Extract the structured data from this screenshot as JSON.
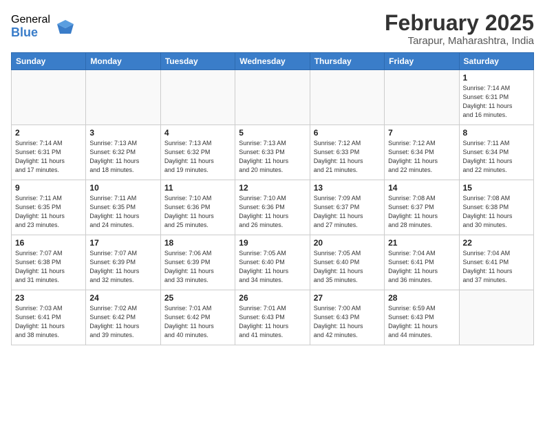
{
  "header": {
    "logo_general": "General",
    "logo_blue": "Blue",
    "month_title": "February 2025",
    "location": "Tarapur, Maharashtra, India"
  },
  "weekdays": [
    "Sunday",
    "Monday",
    "Tuesday",
    "Wednesday",
    "Thursday",
    "Friday",
    "Saturday"
  ],
  "weeks": [
    [
      {
        "day": "",
        "info": ""
      },
      {
        "day": "",
        "info": ""
      },
      {
        "day": "",
        "info": ""
      },
      {
        "day": "",
        "info": ""
      },
      {
        "day": "",
        "info": ""
      },
      {
        "day": "",
        "info": ""
      },
      {
        "day": "1",
        "info": "Sunrise: 7:14 AM\nSunset: 6:31 PM\nDaylight: 11 hours\nand 16 minutes."
      }
    ],
    [
      {
        "day": "2",
        "info": "Sunrise: 7:14 AM\nSunset: 6:31 PM\nDaylight: 11 hours\nand 17 minutes."
      },
      {
        "day": "3",
        "info": "Sunrise: 7:13 AM\nSunset: 6:32 PM\nDaylight: 11 hours\nand 18 minutes."
      },
      {
        "day": "4",
        "info": "Sunrise: 7:13 AM\nSunset: 6:32 PM\nDaylight: 11 hours\nand 19 minutes."
      },
      {
        "day": "5",
        "info": "Sunrise: 7:13 AM\nSunset: 6:33 PM\nDaylight: 11 hours\nand 20 minutes."
      },
      {
        "day": "6",
        "info": "Sunrise: 7:12 AM\nSunset: 6:33 PM\nDaylight: 11 hours\nand 21 minutes."
      },
      {
        "day": "7",
        "info": "Sunrise: 7:12 AM\nSunset: 6:34 PM\nDaylight: 11 hours\nand 22 minutes."
      },
      {
        "day": "8",
        "info": "Sunrise: 7:11 AM\nSunset: 6:34 PM\nDaylight: 11 hours\nand 22 minutes."
      }
    ],
    [
      {
        "day": "9",
        "info": "Sunrise: 7:11 AM\nSunset: 6:35 PM\nDaylight: 11 hours\nand 23 minutes."
      },
      {
        "day": "10",
        "info": "Sunrise: 7:11 AM\nSunset: 6:35 PM\nDaylight: 11 hours\nand 24 minutes."
      },
      {
        "day": "11",
        "info": "Sunrise: 7:10 AM\nSunset: 6:36 PM\nDaylight: 11 hours\nand 25 minutes."
      },
      {
        "day": "12",
        "info": "Sunrise: 7:10 AM\nSunset: 6:36 PM\nDaylight: 11 hours\nand 26 minutes."
      },
      {
        "day": "13",
        "info": "Sunrise: 7:09 AM\nSunset: 6:37 PM\nDaylight: 11 hours\nand 27 minutes."
      },
      {
        "day": "14",
        "info": "Sunrise: 7:08 AM\nSunset: 6:37 PM\nDaylight: 11 hours\nand 28 minutes."
      },
      {
        "day": "15",
        "info": "Sunrise: 7:08 AM\nSunset: 6:38 PM\nDaylight: 11 hours\nand 30 minutes."
      }
    ],
    [
      {
        "day": "16",
        "info": "Sunrise: 7:07 AM\nSunset: 6:38 PM\nDaylight: 11 hours\nand 31 minutes."
      },
      {
        "day": "17",
        "info": "Sunrise: 7:07 AM\nSunset: 6:39 PM\nDaylight: 11 hours\nand 32 minutes."
      },
      {
        "day": "18",
        "info": "Sunrise: 7:06 AM\nSunset: 6:39 PM\nDaylight: 11 hours\nand 33 minutes."
      },
      {
        "day": "19",
        "info": "Sunrise: 7:05 AM\nSunset: 6:40 PM\nDaylight: 11 hours\nand 34 minutes."
      },
      {
        "day": "20",
        "info": "Sunrise: 7:05 AM\nSunset: 6:40 PM\nDaylight: 11 hours\nand 35 minutes."
      },
      {
        "day": "21",
        "info": "Sunrise: 7:04 AM\nSunset: 6:41 PM\nDaylight: 11 hours\nand 36 minutes."
      },
      {
        "day": "22",
        "info": "Sunrise: 7:04 AM\nSunset: 6:41 PM\nDaylight: 11 hours\nand 37 minutes."
      }
    ],
    [
      {
        "day": "23",
        "info": "Sunrise: 7:03 AM\nSunset: 6:41 PM\nDaylight: 11 hours\nand 38 minutes."
      },
      {
        "day": "24",
        "info": "Sunrise: 7:02 AM\nSunset: 6:42 PM\nDaylight: 11 hours\nand 39 minutes."
      },
      {
        "day": "25",
        "info": "Sunrise: 7:01 AM\nSunset: 6:42 PM\nDaylight: 11 hours\nand 40 minutes."
      },
      {
        "day": "26",
        "info": "Sunrise: 7:01 AM\nSunset: 6:43 PM\nDaylight: 11 hours\nand 41 minutes."
      },
      {
        "day": "27",
        "info": "Sunrise: 7:00 AM\nSunset: 6:43 PM\nDaylight: 11 hours\nand 42 minutes."
      },
      {
        "day": "28",
        "info": "Sunrise: 6:59 AM\nSunset: 6:43 PM\nDaylight: 11 hours\nand 44 minutes."
      },
      {
        "day": "",
        "info": ""
      }
    ]
  ]
}
